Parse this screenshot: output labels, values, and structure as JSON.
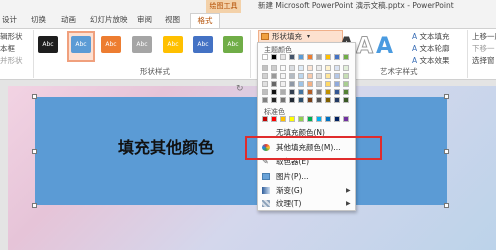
{
  "titlebar": {
    "context_tool": "绘图工具",
    "doc_title": "新建 Microsoft PowerPoint 演示文稿.pptx - PowerPoint"
  },
  "tabs": [
    "设计",
    "切换",
    "动画",
    "幻灯片放映",
    "审阅",
    "视图",
    "格式"
  ],
  "ribbon": {
    "left": {
      "edit_shape": "辑形状",
      "textbox": "本框",
      "merge": "并形状"
    },
    "shape_style_label": "形状样式",
    "style_swatch_text": "Abc",
    "style_colors": [
      "#1e1e1e",
      "#5b9bd5",
      "#ed7d31",
      "#a5a5a5",
      "#ffc000",
      "#4472c4",
      "#70ad47"
    ],
    "fill_button": "形状填充",
    "art_label": "艺术字样式",
    "art_items": {
      "text_fill": "文本填充",
      "text_outline": "文本轮廓",
      "text_effect": "文本效果"
    },
    "right": {
      "bring_forward": "上移一层",
      "send_backward": "下移一",
      "selection_pane": "选择窗"
    },
    "bigA_colors": [
      "#3d3d3d",
      "#ffffff",
      "#4a9be0"
    ]
  },
  "dropdown": {
    "theme_colors_label": "主题颜色",
    "standard_colors_label": "标准色",
    "theme_top": [
      "#ffffff",
      "#000000",
      "#e7e6e6",
      "#44546a",
      "#5b9bd5",
      "#ed7d31",
      "#a5a5a5",
      "#ffc000",
      "#4472c4",
      "#70ad47"
    ],
    "standard": [
      "#c00000",
      "#ff0000",
      "#ffc000",
      "#ffff00",
      "#92d050",
      "#00b050",
      "#00b0f0",
      "#0070c0",
      "#002060",
      "#7030a0"
    ],
    "no_fill": "无填充颜色(N)",
    "more_fill": "其他填充颜色(M)...",
    "eyedropper": "取色器(E)",
    "picture": "图片(P)...",
    "gradient": "渐变(G)",
    "texture": "纹理(T)"
  },
  "slide": {
    "shape_text": "填充其他颜色"
  }
}
